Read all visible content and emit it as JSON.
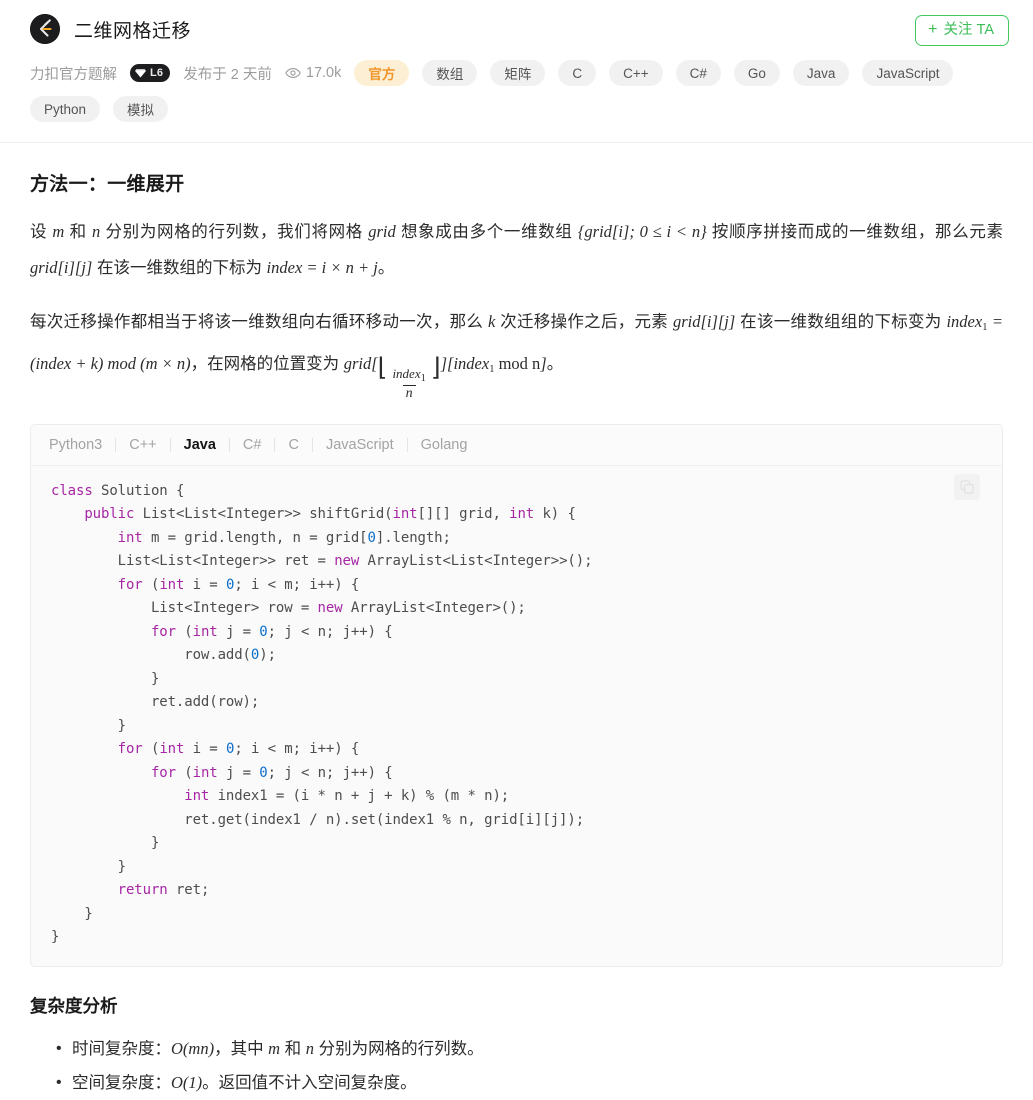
{
  "header": {
    "title": "二维网格迁移",
    "avatar_icon": "leetcode-logo-icon",
    "follow_button": {
      "plus": "+",
      "label": "关注 TA"
    }
  },
  "meta": {
    "author": "力扣官方题解",
    "level_badge": "L6",
    "gem_icon": "gem-icon",
    "date": "发布于 2 天前",
    "views_icon": "eye-icon",
    "views": "17.0k",
    "tags": [
      {
        "label": "官方",
        "official": true
      },
      {
        "label": "数组",
        "official": false
      },
      {
        "label": "矩阵",
        "official": false
      },
      {
        "label": "C",
        "official": false
      },
      {
        "label": "C++",
        "official": false
      },
      {
        "label": "C#",
        "official": false
      },
      {
        "label": "Go",
        "official": false
      },
      {
        "label": "Java",
        "official": false
      },
      {
        "label": "JavaScript",
        "official": false
      },
      {
        "label": "Python",
        "official": false
      },
      {
        "label": "模拟",
        "official": false
      }
    ]
  },
  "article": {
    "method_heading": "方法一：一维展开",
    "para1": {
      "t1": "设 ",
      "m1": "m",
      "t2": " 和 ",
      "m2": "n",
      "t3": " 分别为网格的行列数，我们将网格 ",
      "m3": "grid",
      "t4": " 想象成由多个一维数组 ",
      "m4": "{grid[i]; 0 ≤ i < n}",
      "t5": " 按顺序拼接而成的一维数组，那么元素 ",
      "m5": "grid[i][j]",
      "t6": " 在该一维数组的下标为 ",
      "m6": "index = i × n + j",
      "t7": "。"
    },
    "para2": {
      "t1": "每次迁移操作都相当于将该一维数组向右循环移动一次，那么 ",
      "m1": "k",
      "t2": " 次迁移操作之后，元素 ",
      "m2": "grid[i][j]",
      "t3": " 在该一维数组组的下标变为 ",
      "m3a": "index",
      "m3sub": "1",
      "m3b": " = (index + k) mod (m × n)",
      "t4": "，在网格的位置变为 ",
      "m4pre": "grid[",
      "m4num": "index",
      "m4numsub": "1",
      "m4den": "n",
      "m4mid": "][",
      "m4b": "index",
      "m4bsub": "1",
      "m4c": " mod n",
      "m4end": "]",
      "t5": "。"
    }
  },
  "code": {
    "tabs": [
      {
        "label": "Python3",
        "active": false
      },
      {
        "label": "C++",
        "active": false
      },
      {
        "label": "Java",
        "active": true
      },
      {
        "label": "C#",
        "active": false
      },
      {
        "label": "C",
        "active": false
      },
      {
        "label": "JavaScript",
        "active": false
      },
      {
        "label": "Golang",
        "active": false
      }
    ],
    "copy_icon": "copy-icon",
    "language": "Java",
    "source": "class Solution {\n    public List<List<Integer>> shiftGrid(int[][] grid, int k) {\n        int m = grid.length, n = grid[0].length;\n        List<List<Integer>> ret = new ArrayList<List<Integer>>();\n        for (int i = 0; i < m; i++) {\n            List<Integer> row = new ArrayList<Integer>();\n            for (int j = 0; j < n; j++) {\n                row.add(0);\n            }\n            ret.add(row);\n        }\n        for (int i = 0; i < m; i++) {\n            for (int j = 0; j < n; j++) {\n                int index1 = (i * n + j + k) % (m * n);\n                ret.get(index1 / n).set(index1 % n, grid[i][j]);\n            }\n        }\n        return ret;\n    }\n}"
  },
  "complexity": {
    "heading": "复杂度分析",
    "items": [
      {
        "prefix": "时间复杂度：",
        "big": "O(mn)",
        "suffix_a": "，其中 ",
        "v1": "m",
        "mid": " 和 ",
        "v2": "n",
        "suffix_b": " 分别为网格的行列数。"
      },
      {
        "prefix": "空间复杂度：",
        "big": "O(1)",
        "suffix_a": "。返回值不计入空间复杂度。",
        "v1": "",
        "mid": "",
        "v2": "",
        "suffix_b": ""
      }
    ]
  },
  "colors": {
    "accent_green": "#43c860",
    "official_orange": "#f0962c",
    "official_bg": "#fdefd4",
    "keyword_purple": "#a626a4",
    "number_blue": "#0b6ecb"
  }
}
